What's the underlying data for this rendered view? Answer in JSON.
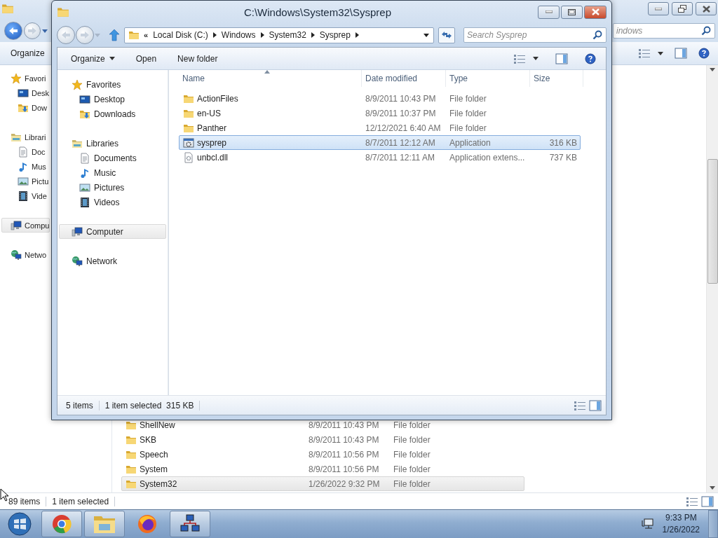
{
  "background_window": {
    "nav_groups": [
      {
        "label": "Favori",
        "kind": "favorites",
        "selected": false,
        "children": [
          {
            "label": "Desk",
            "kind": "desktop",
            "selected": false
          },
          {
            "label": "Dow",
            "kind": "downloads",
            "selected": false
          }
        ]
      },
      {
        "label": "Librari",
        "kind": "libraries",
        "selected": false,
        "children": [
          {
            "label": "Doc",
            "kind": "documents",
            "selected": false
          },
          {
            "label": "Mus",
            "kind": "music",
            "selected": false
          },
          {
            "label": "Pictu",
            "kind": "pictures",
            "selected": false
          },
          {
            "label": "Vide",
            "kind": "videos",
            "selected": false
          }
        ]
      },
      {
        "label": "Compu",
        "kind": "computer",
        "selected": true
      },
      {
        "label": "Netwo",
        "kind": "network",
        "selected": false
      }
    ],
    "toolbar": {
      "organize": "Organize"
    },
    "search": {
      "placeholder": "indows"
    },
    "rows": [
      {
        "name": "ShellNew",
        "date": "8/9/2011 10:43 PM",
        "type": "File folder",
        "kind": "folder",
        "selected": false
      },
      {
        "name": "SKB",
        "date": "8/9/2011 10:43 PM",
        "type": "File folder",
        "kind": "folder",
        "selected": false
      },
      {
        "name": "Speech",
        "date": "8/9/2011 10:56 PM",
        "type": "File folder",
        "kind": "folder",
        "selected": false
      },
      {
        "name": "System",
        "date": "8/9/2011 10:56 PM",
        "type": "File folder",
        "kind": "folder",
        "selected": false
      },
      {
        "name": "System32",
        "date": "1/26/2022 9:32 PM",
        "type": "File folder",
        "kind": "folder",
        "selected": true
      }
    ],
    "status_bar": {
      "items": "89 items",
      "selection": "1 item selected"
    }
  },
  "window": {
    "title": "C:\\Windows\\System32\\Sysprep",
    "address": {
      "overflow": "«",
      "crumbs": [
        "Local Disk (C:)",
        "Windows",
        "System32",
        "Sysprep"
      ]
    },
    "search": {
      "placeholder": "Search Sysprep"
    },
    "toolbar": [
      {
        "label": "Organize",
        "kind": "menu"
      },
      {
        "label": "Open",
        "kind": "button"
      },
      {
        "label": "New folder",
        "kind": "button"
      }
    ],
    "nav_groups": [
      {
        "label": "Favorites",
        "kind": "favorites",
        "selected": false,
        "children": [
          {
            "label": "Desktop",
            "kind": "desktop",
            "selected": false
          },
          {
            "label": "Downloads",
            "kind": "downloads",
            "selected": false
          }
        ]
      },
      {
        "label": "Libraries",
        "kind": "libraries",
        "selected": false,
        "children": [
          {
            "label": "Documents",
            "kind": "documents",
            "selected": false
          },
          {
            "label": "Music",
            "kind": "music",
            "selected": false
          },
          {
            "label": "Pictures",
            "kind": "pictures",
            "selected": false
          },
          {
            "label": "Videos",
            "kind": "videos",
            "selected": false
          }
        ]
      },
      {
        "label": "Computer",
        "kind": "computer",
        "selected": true
      },
      {
        "label": "Network",
        "kind": "network",
        "selected": false
      }
    ],
    "columns": [
      "Name",
      "Date modified",
      "Type",
      "Size"
    ],
    "rows": [
      {
        "name": "ActionFiles",
        "date": "8/9/2011 10:43 PM",
        "type": "File folder",
        "kind": "folder",
        "selected": false
      },
      {
        "name": "en-US",
        "date": "8/9/2011 10:37 PM",
        "type": "File folder",
        "kind": "folder",
        "selected": false
      },
      {
        "name": "Panther",
        "date": "12/12/2021 6:40 AM",
        "type": "File folder",
        "kind": "folder",
        "selected": false
      },
      {
        "name": "sysprep",
        "date": "8/7/2011 12:12 AM",
        "type": "Application",
        "size": "316 KB",
        "kind": "application",
        "selected": true
      },
      {
        "name": "unbcl.dll",
        "date": "8/7/2011 12:11 AM",
        "type": "Application extens...",
        "size": "737 KB",
        "kind": "dll",
        "selected": false
      }
    ],
    "status_bar": {
      "items": "5 items",
      "selection": "1 item selected",
      "size": "315 KB"
    }
  },
  "taskbar": {
    "apps": [
      {
        "kind": "chrome",
        "active": true
      },
      {
        "kind": "explorer",
        "active": true
      },
      {
        "kind": "firefox",
        "active": false
      },
      {
        "kind": "network_app",
        "active": true
      }
    ],
    "clock": {
      "time": "9:33 PM",
      "date": "1/26/2022"
    }
  }
}
